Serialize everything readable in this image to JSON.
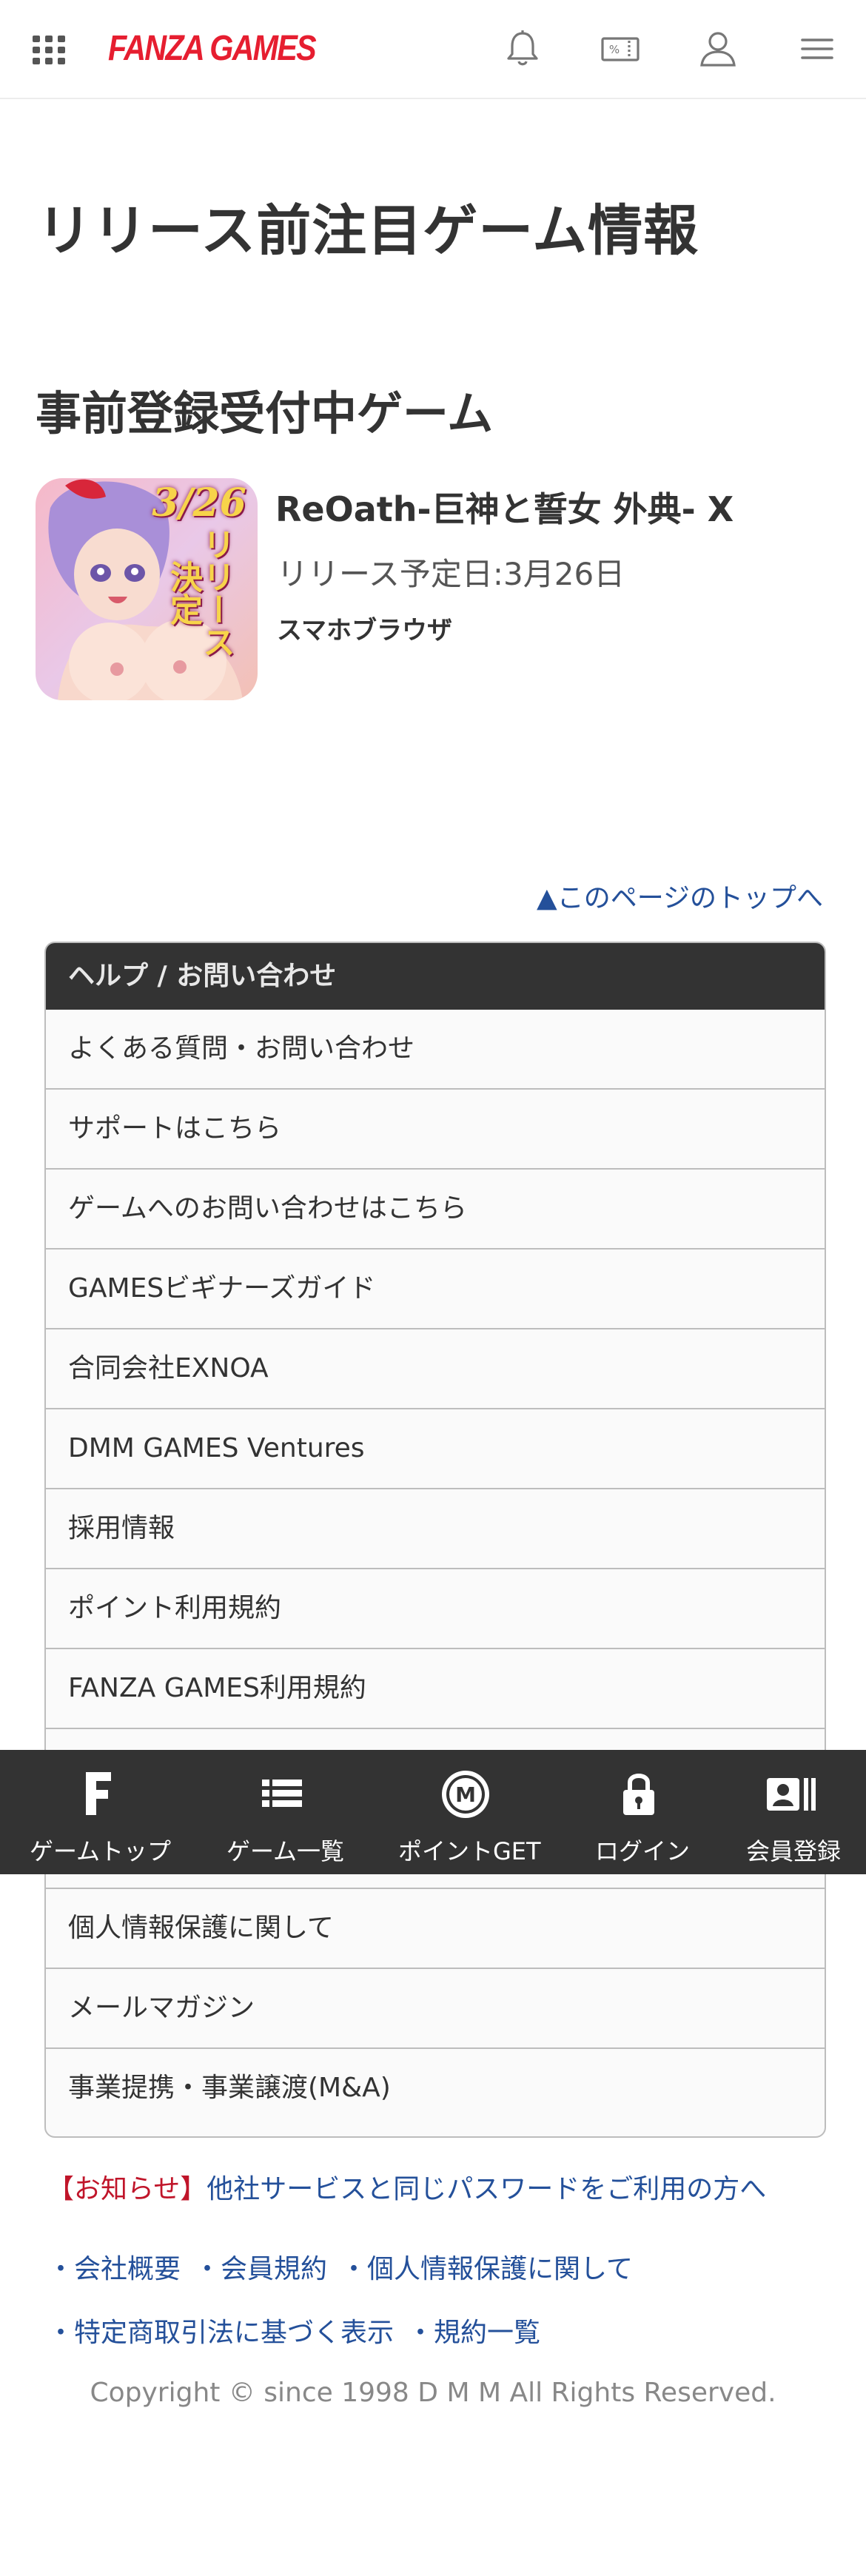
{
  "header": {
    "logo": "FANZA GAMES",
    "brand_color": "#e61e30"
  },
  "page_title": "リリース前注目ゲーム情報",
  "section_title": "事前登録受付中ゲーム",
  "game": {
    "title": "ReOath-巨神と誓女 外典- X",
    "release": "リリース予定日:3月26日",
    "platform": "スマホブラウザ",
    "thumb_date": "3/26",
    "thumb_text": "リリース決定"
  },
  "to_top": "▲このページのトップへ",
  "help": {
    "heading": "ヘルプ / お問い合わせ",
    "items": [
      "よくある質問・お問い合わせ",
      "サポートはこちら",
      "ゲームへのお問い合わせはこちら",
      "GAMESビギナーズガイド",
      "合同会社EXNOA",
      "DMM GAMES Ventures",
      "採用情報",
      "ポイント利用規約",
      "FANZA GAMES利用規約",
      "",
      "",
      "個人情報保護に関して",
      "メールマガジン",
      "事業提携・事業譲渡(M&A)"
    ]
  },
  "bottom_nav": [
    {
      "label": "ゲームトップ",
      "icon": "f-logo-icon"
    },
    {
      "label": "ゲーム一覧",
      "icon": "list-icon"
    },
    {
      "label": "ポイントGET",
      "icon": "m-coin-icon"
    },
    {
      "label": "ログイン",
      "icon": "lock-icon"
    },
    {
      "label": "会員登録",
      "icon": "id-card-icon"
    }
  ],
  "notice": {
    "tag": "【お知らせ】",
    "text": "他社サービスと同じパスワードをご利用の方へ"
  },
  "footer_links_row1": [
    "・会社概要",
    "・会員規約",
    "・個人情報保護に関して"
  ],
  "footer_links_row2": [
    "・特定商取引法に基づく表示",
    "・規約一覧"
  ],
  "copyright": "Copyright © since 1998 D M M All Rights Reserved."
}
